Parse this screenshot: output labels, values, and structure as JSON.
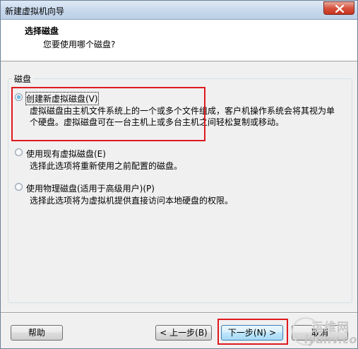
{
  "window": {
    "title": "新建虚拟机向导"
  },
  "header": {
    "title": "选择磁盘",
    "subtitle": "您要使用哪个磁盘?"
  },
  "group": {
    "label": "磁盘"
  },
  "options": [
    {
      "label": "创建新虚拟磁盘(V)",
      "description": "虚拟磁盘由主机文件系统上的一个或多个文件组成，客户机操作系统会将其视为单\n个硬盘。虚拟磁盘可在一台主机上或多台主机之间轻松复制或移动。",
      "checked": true
    },
    {
      "label": "使用现有虚拟磁盘(E)",
      "description": "选择此选项将重新使用之前配置的磁盘。",
      "checked": false
    },
    {
      "label": "使用物理磁盘(适用于高级用户)(P)",
      "description": "选择此选项将为虚拟机提供直接访问本地硬盘的权限。",
      "checked": false
    }
  ],
  "buttons": {
    "help": "帮助",
    "back": "< 上一步(B)",
    "next": "下一步(N) >",
    "cancel": "取消"
  },
  "watermark": {
    "cn": "运维网",
    "en": "iyunv.com"
  },
  "colors": {
    "highlight": "#e0191f",
    "accent": "#3c7fb1"
  }
}
